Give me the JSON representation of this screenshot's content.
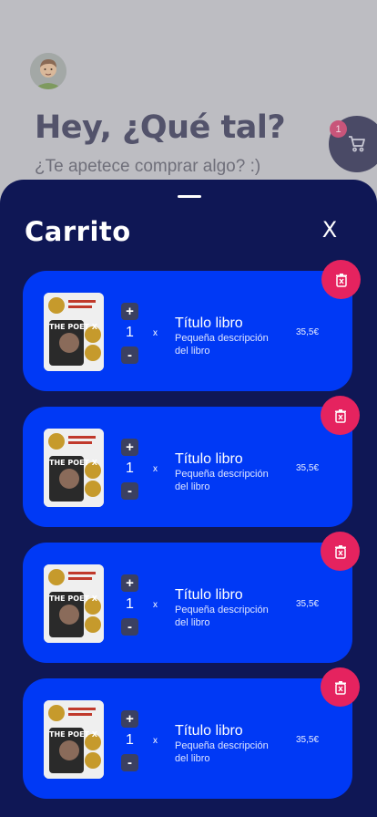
{
  "background": {
    "greeting": "Hey, ¿Qué tal?",
    "subtitle": "¿Te apetece comprar algo? :)",
    "cart_badge_count": "1",
    "avatar_icon": "user-avatar",
    "cart_icon": "shopping-cart-icon"
  },
  "sheet": {
    "title": "Carrito",
    "close_label": "X"
  },
  "cart_items": [
    {
      "quantity": "1",
      "multiplier": "x",
      "title": "Título libro",
      "description": "Pequeña descripción del libro",
      "price": "35,5€",
      "plus": "+",
      "minus": "-",
      "cover_text": "THE POET X"
    },
    {
      "quantity": "1",
      "multiplier": "x",
      "title": "Título libro",
      "description": "Pequeña descripción del libro",
      "price": "35,5€",
      "plus": "+",
      "minus": "-",
      "cover_text": "THE POET X"
    },
    {
      "quantity": "1",
      "multiplier": "x",
      "title": "Título libro",
      "description": "Pequeña descripción del libro",
      "price": "35,5€",
      "plus": "+",
      "minus": "-",
      "cover_text": "THE POET X"
    },
    {
      "quantity": "1",
      "multiplier": "x",
      "title": "Título libro",
      "description": "Pequeña descripción del libro",
      "price": "35,5€",
      "plus": "+",
      "minus": "-",
      "cover_text": "THE POET X"
    }
  ],
  "colors": {
    "sheet_bg": "#0f1755",
    "item_bg": "#0039f5",
    "delete_bg": "#e5235f",
    "qty_btn_bg": "#3b4061"
  }
}
